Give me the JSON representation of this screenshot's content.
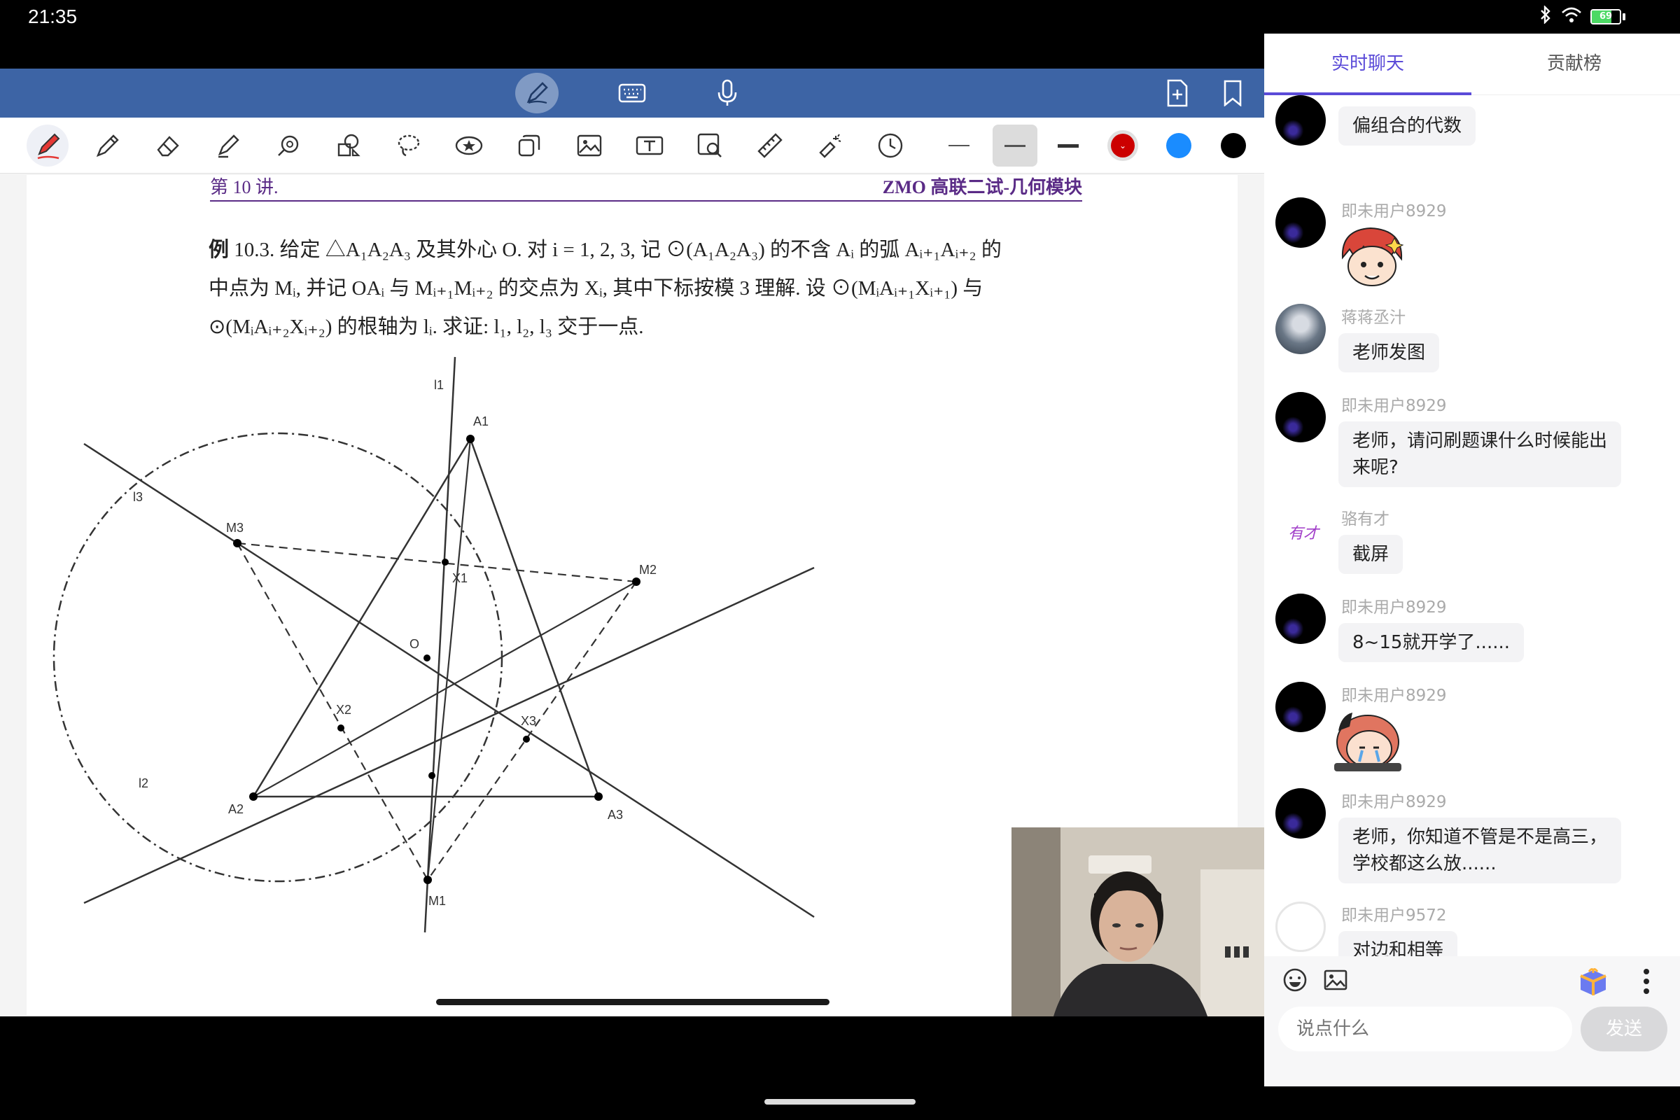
{
  "status": {
    "time": "21:35",
    "battery": "69",
    "battery_level": 0.69
  },
  "app": {
    "top_buttons": [
      "pen-mode",
      "keyboard",
      "microphone",
      "add-page",
      "bookmark"
    ],
    "tools": [
      "pen",
      "pencil",
      "eraser",
      "highlighter",
      "magnifier",
      "shapes",
      "lasso",
      "sticker",
      "copy",
      "image",
      "text",
      "image-search",
      "ruler",
      "laser",
      "timer"
    ],
    "colors": {
      "red": "#cc0000",
      "blue": "#1a8cff",
      "black": "#000000",
      "accent": "#3d64a5"
    }
  },
  "doc": {
    "header_left": "第 10 讲.",
    "header_right": "ZMO 高联二试-几何模块",
    "problem_label": "例",
    "problem_lines": [
      " 10.3. 给定 △A₁A₂A₃ 及其外心 O. 对 i = 1, 2, 3, 记 ⊙(A₁A₂A₃) 的不含 Aᵢ 的弧 Aᵢ₊₁Aᵢ₊₂ 的",
      "中点为 Mᵢ, 并记 OAᵢ 与 Mᵢ₊₁Mᵢ₊₂ 的交点为 Xᵢ, 其中下标按模 3 理解. 设 ⊙(MᵢAᵢ₊₁Xᵢ₊₁) 与",
      "⊙(MᵢAᵢ₊₂Xᵢ₊₂) 的根轴为 lᵢ. 求证: l₁, l₂, l₃ 交于一点."
    ],
    "figure_labels": {
      "l1": "l1",
      "l2": "l2",
      "l3": "l3",
      "A1": "A1",
      "A2": "A2",
      "A3": "A3",
      "M1": "M1",
      "M2": "M2",
      "M3": "M3",
      "X1": "X1",
      "X2": "X2",
      "X3": "X3",
      "O": "O"
    }
  },
  "chat": {
    "tabs": [
      "实时聊天",
      "贡献榜"
    ],
    "messages": [
      {
        "name": "",
        "text": "偏组合的代数"
      },
      {
        "name": "即未用户8929",
        "sticker": "red-hair-boy-sticker"
      },
      {
        "name": "蒋蒋丞汁",
        "text": "老师发图"
      },
      {
        "name": "即未用户8929",
        "text": "老师，请问刷题课什么时候能出",
        "text2": "来呢?"
      },
      {
        "name": "骆有才",
        "avatar_text": "有才",
        "text": "截屏"
      },
      {
        "name": "即未用户8929",
        "text": "8~15就开学了......"
      },
      {
        "name": "即未用户8929",
        "sticker": "crying-girl-sticker"
      },
      {
        "name": "即未用户8929",
        "text": "老师，你知道不管是不是高三，",
        "text2": "学校都这么放......"
      },
      {
        "name": "即未用户9572",
        "text": "对边和相等"
      }
    ],
    "input_placeholder": "说点什么",
    "send_label": "发送"
  }
}
